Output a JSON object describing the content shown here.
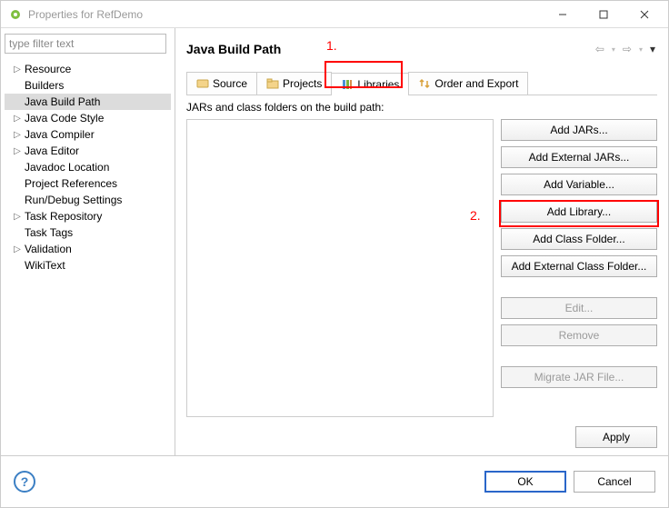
{
  "window": {
    "title": "Properties for RefDemo"
  },
  "filter": {
    "placeholder": "type filter text"
  },
  "tree": {
    "items": [
      {
        "label": "Resource",
        "expandable": true,
        "selected": false
      },
      {
        "label": "Builders",
        "expandable": false,
        "selected": false
      },
      {
        "label": "Java Build Path",
        "expandable": false,
        "selected": true
      },
      {
        "label": "Java Code Style",
        "expandable": true,
        "selected": false
      },
      {
        "label": "Java Compiler",
        "expandable": true,
        "selected": false
      },
      {
        "label": "Java Editor",
        "expandable": true,
        "selected": false
      },
      {
        "label": "Javadoc Location",
        "expandable": false,
        "selected": false
      },
      {
        "label": "Project References",
        "expandable": false,
        "selected": false
      },
      {
        "label": "Run/Debug Settings",
        "expandable": false,
        "selected": false
      },
      {
        "label": "Task Repository",
        "expandable": true,
        "selected": false
      },
      {
        "label": "Task Tags",
        "expandable": false,
        "selected": false
      },
      {
        "label": "Validation",
        "expandable": true,
        "selected": false
      },
      {
        "label": "WikiText",
        "expandable": false,
        "selected": false
      }
    ]
  },
  "right": {
    "header": "Java Build Path",
    "subtitle": "JARs and class folders on the build path:",
    "tabs": [
      {
        "label": "Source"
      },
      {
        "label": "Projects"
      },
      {
        "label": "Libraries"
      },
      {
        "label": "Order and Export"
      }
    ],
    "buttons": {
      "add_jars": "Add JARs...",
      "add_external_jars": "Add External JARs...",
      "add_variable": "Add Variable...",
      "add_library": "Add Library...",
      "add_class_folder": "Add Class Folder...",
      "add_external_class_folder": "Add External Class Folder...",
      "edit": "Edit...",
      "remove": "Remove",
      "migrate": "Migrate JAR File...",
      "apply": "Apply"
    }
  },
  "footer": {
    "ok": "OK",
    "cancel": "Cancel"
  },
  "annotations": {
    "one": "1.",
    "two": "2."
  }
}
